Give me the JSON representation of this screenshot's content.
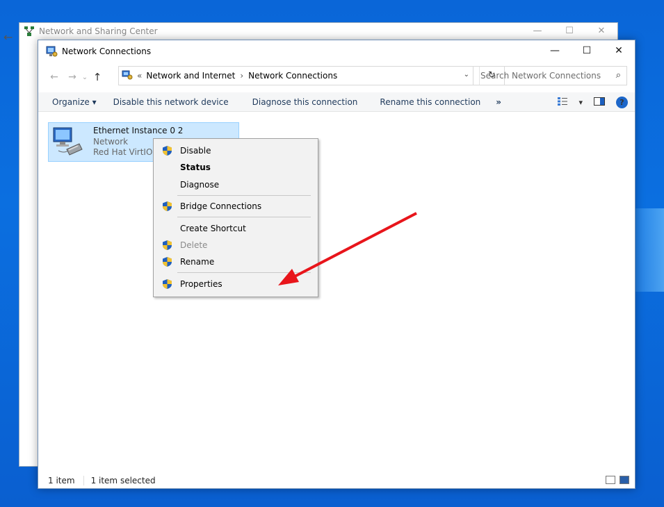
{
  "back_window": {
    "title": "Network and Sharing Center",
    "minimize": "—",
    "maximize": "☐",
    "close": "✕",
    "back_arrow": "←"
  },
  "window": {
    "title": "Network Connections",
    "minimize": "—",
    "maximize": "☐",
    "close": "✕"
  },
  "nav": {
    "back": "←",
    "forward": "→",
    "recent": "⌄",
    "up": "↑",
    "breadcrumb_overflow": "«",
    "breadcrumbs": [
      "Network and Internet",
      "Network Connections"
    ],
    "breadcrumb_sep": "›",
    "dropdown": "⌄",
    "refresh": "↻",
    "search_placeholder": "Search Network Connections",
    "search_icon": "⌕"
  },
  "commands": {
    "organize": "Organize ▾",
    "disable": "Disable this network device",
    "diagnose": "Diagnose this connection",
    "rename": "Rename this connection",
    "more": "»",
    "view_dropdown": "▾",
    "help": "?"
  },
  "item": {
    "name": "Ethernet Instance 0 2",
    "status": "Network",
    "device": "Red Hat VirtIO"
  },
  "context_menu": {
    "items": [
      {
        "label": "Disable",
        "shield": true
      },
      {
        "label": "Status",
        "bold": true
      },
      {
        "label": "Diagnose"
      },
      {
        "label": "Bridge Connections",
        "shield": true
      },
      {
        "label": "Create Shortcut"
      },
      {
        "label": "Delete",
        "shield": true,
        "disabled": true
      },
      {
        "label": "Rename",
        "shield": true
      },
      {
        "label": "Properties",
        "shield": true
      }
    ]
  },
  "statusbar": {
    "count": "1 item",
    "selected": "1 item selected"
  },
  "colors": {
    "accent_arrow": "#e8151b",
    "selection": "#cce8ff",
    "desktop": "#0a66d8"
  }
}
